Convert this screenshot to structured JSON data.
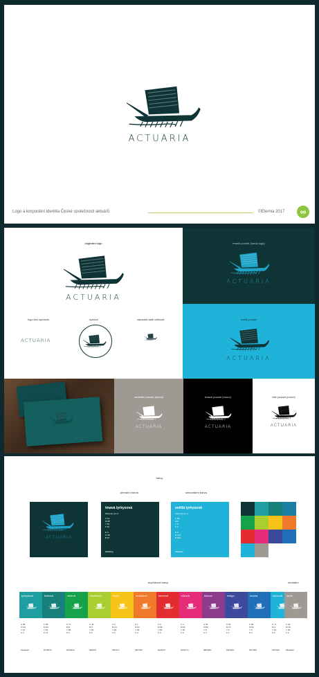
{
  "cover": {
    "brand": "ACTUARIA",
    "footer_left": "Logo a korporátní identita České společnosti aktuárů",
    "footer_right": "©Eternia 2017",
    "badge": "∞"
  },
  "variants": {
    "original_label": "originální logo",
    "dark_label": "tmavé pozadí (barva loga)",
    "blue_label": "světlé pozadí",
    "nosymbol_label": "logo bez symbolu",
    "symbol_label": "symbol",
    "small_label": "varianta malé velikosti",
    "gray_label": "neutrální pozadí (mono)",
    "black_label": "tmavé pozadí (mono)",
    "white_label": "bílé pozadí (mono)"
  },
  "colors": {
    "heading": "barvy",
    "primary_label": "primární barva",
    "secondary_label": "sekundární barva",
    "primary_title": "tmavá tyrkysová",
    "primary_sub": "Pantone pro C",
    "primary_cmyk": "C 91\nM 65\nY 60\nK 62\n\nR 0\nG 48\nB 57",
    "primary_hex": "#00303g",
    "secondary_title": "světlá tyrkysová",
    "secondary_sub": "Pantone pro C",
    "secondary_cmyk": "C 68\nM 0\nY 5\nK 0\n\nR 0\nG 171\nB 220",
    "secondary_hex": "#00abdb",
    "extra_label": "doplňkové barvy",
    "neutral_label": "neutrální",
    "swatches": [
      {
        "name": "tyrkysová",
        "color": "#1e9ea0",
        "values": "C 85\nM 19\nY 41\nK 2",
        "hex": "#1e9ea0"
      },
      {
        "name": "tealová",
        "color": "#17807a",
        "values": "C 85\nM 29\nY 59\nK 11",
        "hex": "#17807a"
      },
      {
        "name": "zelená",
        "color": "#14a34a",
        "values": "C 77\nM 8\nY 98\nK 0",
        "hex": "#14a34a"
      },
      {
        "name": "limetková",
        "color": "#a8cf2f",
        "values": "C 44\nM 0\nY 95\nK 0",
        "hex": "#a8cf2f"
      },
      {
        "name": "žlutá",
        "color": "#f6c417",
        "values": "C 3\nM 24\nY 94\nK 0",
        "hex": "#f6c417"
      },
      {
        "name": "oranžová",
        "color": "#f0792b",
        "values": "C 1\nM 64\nY 90\nK 0",
        "hex": "#f0792b"
      },
      {
        "name": "červená",
        "color": "#e22c2f",
        "values": "C 5\nM 95\nY 89\nK 0",
        "hex": "#e22c2f"
      },
      {
        "name": "růžová",
        "color": "#e52c7a",
        "values": "C 4\nM 93\nY 20\nK 0",
        "hex": "#e52c7a"
      },
      {
        "name": "fialová",
        "color": "#8b3a8c",
        "values": "C 52\nM 88\nY 8\nK 0",
        "hex": "#8b3a8c"
      },
      {
        "name": "indigo",
        "color": "#3b4a9c",
        "values": "C 87\nM 77\nY 5\nK 1",
        "hex": "#3b4a9c"
      },
      {
        "name": "modrá",
        "color": "#1f70b8",
        "values": "C 86\nM 52\nY 0\nK 0",
        "hex": "#1f70b8"
      },
      {
        "name": "azurová",
        "color": "#1fb3d9",
        "values": "C 71\nM 4\nY 10\nK 0",
        "hex": "#1fb3d9"
      }
    ],
    "neutral": {
      "name": "šedá",
      "color": "#9e9a93",
      "values": "C 39\nM 33\nY 38\nK 2",
      "hex": "#9e9a93"
    },
    "grid": [
      "#0f3436",
      "#1e9ea0",
      "#17807a",
      "#1a7fa0",
      "#14a34a",
      "#a8cf2f",
      "#f6c417",
      "#f0792b",
      "#e22c2f",
      "#e52c7a",
      "#3b4a9c",
      "#1f70b8",
      "#1fb3d9",
      "#9e9a93",
      "#ffffff",
      "#ffffff"
    ]
  }
}
